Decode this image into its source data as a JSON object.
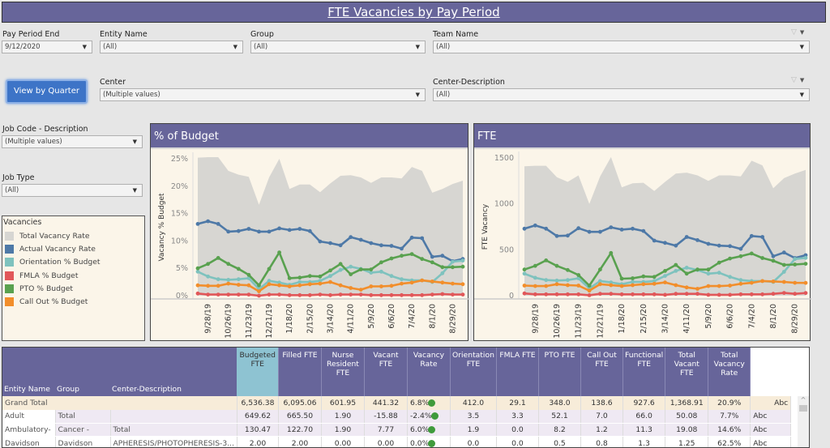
{
  "title": "FTE Vacancies by Pay Period",
  "filters": {
    "pay_period_end": {
      "label": "Pay Period End",
      "value": "9/12/2020"
    },
    "entity_name": {
      "label": "Entity Name",
      "value": "(All)"
    },
    "group": {
      "label": "Group",
      "value": "(All)"
    },
    "team_name": {
      "label": "Team Name",
      "value": "(All)"
    },
    "center": {
      "label": "Center",
      "value": "(Multiple values)"
    },
    "center_description": {
      "label": "Center-Description",
      "value": "(All)"
    },
    "job_code": {
      "label": "Job Code - Description",
      "value": "(Multiple values)"
    },
    "job_type": {
      "label": "Job Type",
      "value": "(All)"
    }
  },
  "view_button": "View by Quarter",
  "legend": {
    "title": "Vacancies",
    "items": [
      {
        "label": "Total Vacancy Rate",
        "color": "#d7d6d2"
      },
      {
        "label": "Actual Vacancy Rate",
        "color": "#4e79a7"
      },
      {
        "label": "Orientation % Budget",
        "color": "#7ec2be"
      },
      {
        "label": "FMLA % Budget",
        "color": "#e15759"
      },
      {
        "label": "PTO % Budget",
        "color": "#59a14f"
      },
      {
        "label": "Call Out % Budget",
        "color": "#f28e2b"
      }
    ]
  },
  "chart_data": [
    {
      "type": "line",
      "title": "% of Budget",
      "xlabel": "",
      "ylabel": "Vacancy % Budget",
      "ylim": [
        0,
        25
      ],
      "yticks": [
        "0%",
        "5%",
        "10%",
        "15%",
        "20%",
        "25%"
      ],
      "ytick_values": [
        0,
        5,
        10,
        15,
        20,
        25
      ],
      "xtick_labels": [
        "9/28/19",
        "10/26/19",
        "11/23/19",
        "12/21/19",
        "1/18/20",
        "2/15/20",
        "3/14/20",
        "4/11/20",
        "5/9/20",
        "6/6/20",
        "7/4/20",
        "8/1/20",
        "8/29/20"
      ],
      "n_points": 27,
      "series": [
        {
          "name": "Total Vacancy Rate",
          "kind": "area",
          "values": [
            25.2,
            25.3,
            25.3,
            22.8,
            22.1,
            21.7,
            16.6,
            21.6,
            25.0,
            19.5,
            20.3,
            20.3,
            18.9,
            20.5,
            21.9,
            22.0,
            21.6,
            20.6,
            21.6,
            21.6,
            21.4,
            23.5,
            22.8,
            18.8,
            19.5,
            20.4,
            21.0
          ]
        },
        {
          "name": "Actual Vacancy Rate",
          "values": [
            13.1,
            13.6,
            13.1,
            11.7,
            11.8,
            12.2,
            11.7,
            11.7,
            12.3,
            12.0,
            12.2,
            11.8,
            9.9,
            9.6,
            9.2,
            10.7,
            10.2,
            9.6,
            9.2,
            9.1,
            8.6,
            10.6,
            10.5,
            7.1,
            7.3,
            6.3,
            6.7
          ]
        },
        {
          "name": "Orientation % Budget",
          "values": [
            4.4,
            3.5,
            3.0,
            2.9,
            3.0,
            3.2,
            1.2,
            2.7,
            2.4,
            2.0,
            2.5,
            2.5,
            2.7,
            3.6,
            4.7,
            5.3,
            4.9,
            4.2,
            4.4,
            3.6,
            3.0,
            2.8,
            2.8,
            2.5,
            4.1,
            6.2,
            6.4
          ]
        },
        {
          "name": "FMLA % Budget",
          "values": [
            0.4,
            0.2,
            0.2,
            0.2,
            0.2,
            0.2,
            0.0,
            0.2,
            0.2,
            0.1,
            0.1,
            0.1,
            0.2,
            0.1,
            0.2,
            0.2,
            0.2,
            0.1,
            0.1,
            0.1,
            0.1,
            0.1,
            0.1,
            0.2,
            0.3,
            0.2,
            0.2
          ]
        },
        {
          "name": "PTO % Budget",
          "values": [
            5.0,
            5.8,
            6.9,
            5.8,
            4.9,
            3.8,
            1.9,
            4.9,
            7.9,
            3.2,
            3.3,
            3.6,
            3.5,
            4.6,
            5.8,
            3.9,
            4.8,
            4.8,
            6.1,
            6.8,
            7.3,
            7.6,
            6.7,
            6.1,
            5.2,
            5.2,
            5.3
          ]
        },
        {
          "name": "Call Out % Budget",
          "values": [
            1.9,
            1.8,
            1.8,
            2.2,
            2.0,
            1.9,
            0.8,
            2.1,
            1.9,
            1.7,
            1.9,
            2.1,
            2.2,
            2.5,
            1.9,
            1.4,
            1.1,
            1.7,
            1.7,
            1.8,
            2.2,
            2.4,
            2.8,
            2.6,
            2.4,
            2.2,
            2.1
          ]
        }
      ]
    },
    {
      "type": "line",
      "title": "FTE",
      "xlabel": "",
      "ylabel": "FTE Vacancy",
      "ylim": [
        0,
        1500
      ],
      "yticks": [
        "0",
        "500",
        "1000",
        "1500"
      ],
      "ytick_values": [
        0,
        500,
        1000,
        1500
      ],
      "xtick_labels": [
        "9/28/19",
        "10/26/19",
        "11/23/19",
        "12/21/19",
        "1/18/20",
        "2/15/20",
        "3/14/20",
        "4/11/20",
        "5/9/20",
        "6/6/20",
        "7/4/20",
        "8/1/20",
        "8/29/20"
      ],
      "n_points": 27,
      "series": [
        {
          "name": "Total Vacancy Rate",
          "kind": "area",
          "values": [
            1410,
            1415,
            1415,
            1290,
            1240,
            1310,
            1000,
            1300,
            1510,
            1180,
            1225,
            1230,
            1140,
            1240,
            1330,
            1340,
            1310,
            1250,
            1310,
            1310,
            1300,
            1470,
            1420,
            1170,
            1280,
            1330,
            1369
          ]
        },
        {
          "name": "Actual Vacancy Rate",
          "values": [
            730,
            765,
            730,
            650,
            655,
            735,
            695,
            695,
            745,
            720,
            730,
            705,
            600,
            575,
            545,
            640,
            605,
            565,
            545,
            540,
            510,
            650,
            640,
            430,
            470,
            410,
            441
          ]
        },
        {
          "name": "Orientation % Budget",
          "values": [
            240,
            195,
            170,
            165,
            170,
            190,
            80,
            160,
            145,
            125,
            150,
            150,
            160,
            215,
            270,
            305,
            280,
            240,
            250,
            205,
            170,
            160,
            160,
            150,
            260,
            400,
            412
          ]
        },
        {
          "name": "FMLA % Budget",
          "values": [
            25,
            15,
            15,
            15,
            15,
            15,
            5,
            20,
            20,
            15,
            15,
            15,
            15,
            10,
            20,
            20,
            20,
            10,
            10,
            10,
            15,
            15,
            15,
            20,
            30,
            20,
            29
          ]
        },
        {
          "name": "PTO % Budget",
          "values": [
            285,
            325,
            385,
            325,
            280,
            225,
            110,
            285,
            465,
            185,
            190,
            210,
            205,
            270,
            335,
            240,
            285,
            285,
            360,
            405,
            430,
            460,
            410,
            380,
            335,
            340,
            348
          ]
        },
        {
          "name": "Call Out % Budget",
          "values": [
            110,
            105,
            105,
            125,
            115,
            110,
            55,
            125,
            115,
            105,
            115,
            125,
            130,
            145,
            115,
            90,
            75,
            105,
            105,
            110,
            130,
            140,
            160,
            155,
            150,
            140,
            139
          ]
        }
      ]
    }
  ],
  "table": {
    "row_headers": [
      "Entity Name",
      "Group",
      "Center-Description"
    ],
    "columns": [
      "Budgeted FTE",
      "Filled FTE",
      "Nurse Resident FTE",
      "Vacant FTE",
      "Vacancy Rate",
      "Orientation FTE",
      "FMLA FTE",
      "PTO FTE",
      "Call Out FTE",
      "Functional FTE",
      "Total Vacant FTE",
      "Total Vacancy Rate"
    ],
    "rows": [
      {
        "kind": "grand",
        "entity": "Grand Total",
        "group": "",
        "center": "",
        "values": [
          "6,536.38",
          "6,095.06",
          "601.95",
          "441.32",
          "6.8%",
          "412.0",
          "29.1",
          "348.0",
          "138.6",
          "927.6",
          "1,368.91",
          "20.9%"
        ],
        "extra": "Abc"
      },
      {
        "kind": "sub",
        "entity": "Adult",
        "group": "Total",
        "center": "",
        "values": [
          "649.62",
          "665.50",
          "1.90",
          "-15.88",
          "-2.4%",
          "3.5",
          "3.3",
          "52.1",
          "7.0",
          "66.0",
          "50.08",
          "7.7%"
        ],
        "extra": "Abc"
      },
      {
        "kind": "sub",
        "entity": "Ambulatory-",
        "group": "Cancer -",
        "center": "Total",
        "values": [
          "130.47",
          "122.70",
          "1.90",
          "7.77",
          "6.0%",
          "1.9",
          "0.0",
          "8.2",
          "1.2",
          "11.3",
          "19.08",
          "14.6%"
        ],
        "extra": "Abc"
      },
      {
        "kind": "row",
        "entity": "Davidson",
        "group": "Davidson",
        "center": "APHERESIS/PHOTOPHERESIS-3...",
        "values": [
          "2.00",
          "2.00",
          "0.00",
          "0.00",
          "0.0%",
          "0.0",
          "0.0",
          "0.5",
          "0.8",
          "1.3",
          "1.25",
          "62.5%"
        ],
        "extra": "Abc"
      }
    ]
  }
}
